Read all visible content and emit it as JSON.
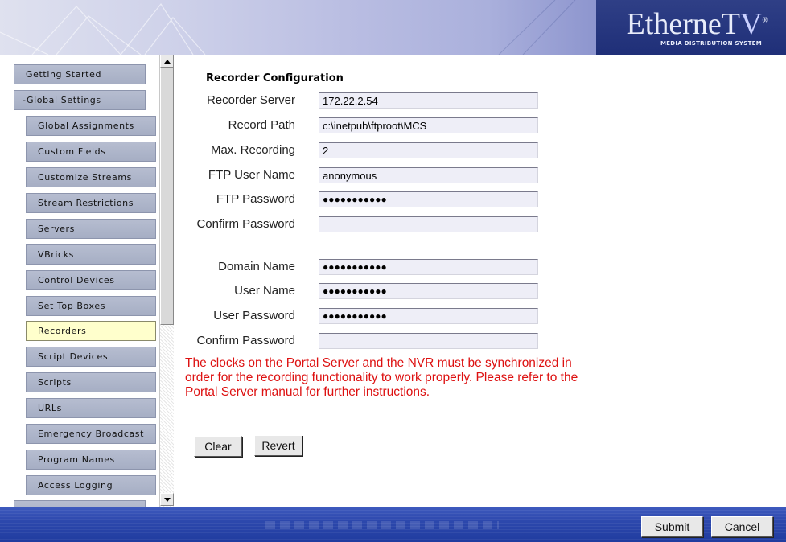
{
  "header": {
    "logo_main": "EtherneT",
    "logo_tv": "V",
    "logo_reg": "®",
    "logo_sub": "MEDIA DISTRIBUTION SYSTEM"
  },
  "sidebar": {
    "items": [
      {
        "label": "Getting Started"
      },
      {
        "label": "-Global Settings"
      },
      {
        "label": "Global Assignments"
      },
      {
        "label": "Custom Fields"
      },
      {
        "label": "Customize Streams"
      },
      {
        "label": "Stream Restrictions"
      },
      {
        "label": "Servers"
      },
      {
        "label": "VBricks"
      },
      {
        "label": "Control Devices"
      },
      {
        "label": "Set Top Boxes"
      },
      {
        "label": "Recorders"
      },
      {
        "label": "Script Devices"
      },
      {
        "label": "Scripts"
      },
      {
        "label": "URLs"
      },
      {
        "label": "Emergency Broadcast"
      },
      {
        "label": "Program Names"
      },
      {
        "label": "Access Logging"
      }
    ]
  },
  "form": {
    "title": "Recorder Configuration",
    "recorder_server": {
      "label": "Recorder Server",
      "value": "172.22.2.54"
    },
    "record_path": {
      "label": "Record Path",
      "value": "c:\\inetpub\\ftproot\\MCS"
    },
    "max_recording": {
      "label": "Max. Recording",
      "value": "2"
    },
    "ftp_user": {
      "label": "FTP User Name",
      "value": "anonymous"
    },
    "ftp_password": {
      "label": "FTP Password",
      "value": "●●●●●●●●●●●"
    },
    "ftp_confirm": {
      "label": "Confirm Password",
      "value": ""
    },
    "domain_name": {
      "label": "Domain Name",
      "value": "●●●●●●●●●●●"
    },
    "user_name": {
      "label": "User Name",
      "value": "●●●●●●●●●●●"
    },
    "user_password": {
      "label": "User Password",
      "value": "●●●●●●●●●●●"
    },
    "user_confirm": {
      "label": "Confirm Password",
      "value": ""
    },
    "warning": "The clocks on the Portal Server and the NVR must be synchronized in order for the recording functionality to work properly. Please refer to the Portal Server manual for further instructions.",
    "clear_label": "Clear",
    "revert_label": "Revert"
  },
  "footer": {
    "submit_label": "Submit",
    "cancel_label": "Cancel"
  },
  "colors": {
    "nav_button": "#aab1c6",
    "nav_active": "#ffffcc",
    "field_bg": "#eeeef7",
    "warning": "#dd1111",
    "footer": "#2d48ad"
  }
}
